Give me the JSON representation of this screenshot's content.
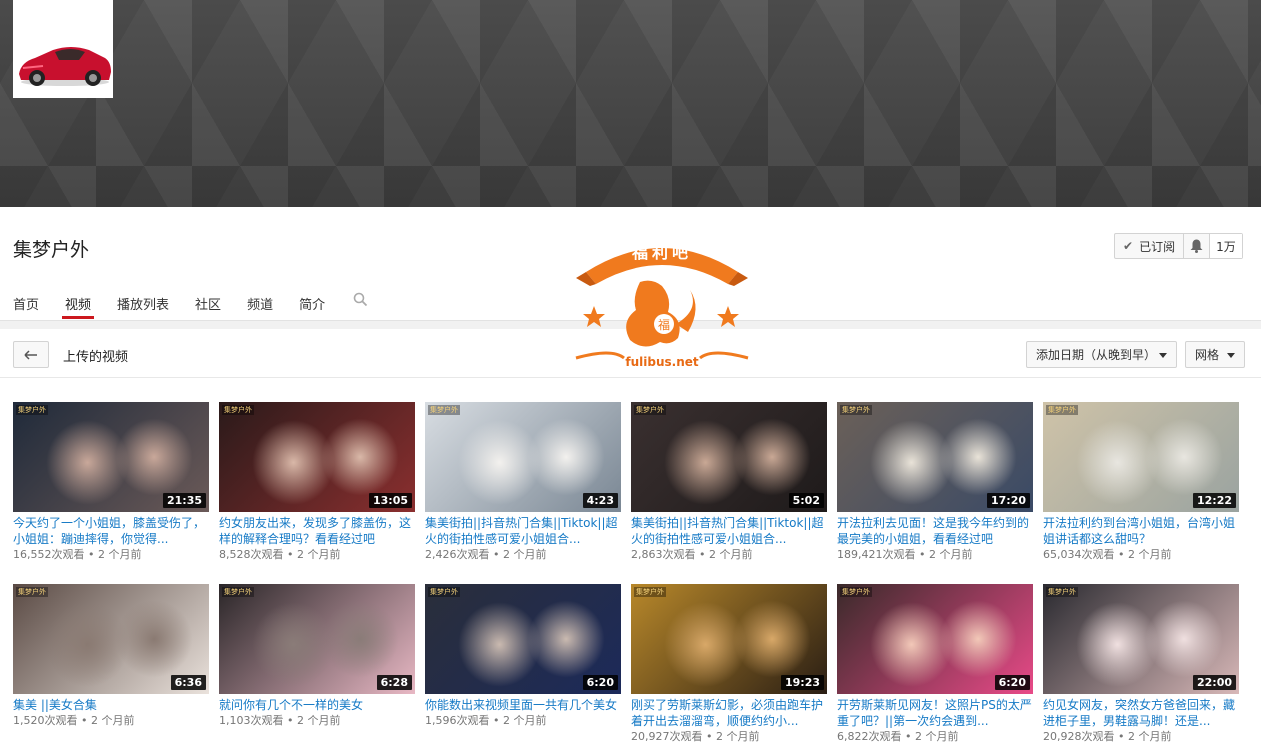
{
  "channel": {
    "name": "集梦户外",
    "subscribed_label": "已订阅",
    "subscriber_count": "1万"
  },
  "tabs": [
    "首页",
    "视频",
    "播放列表",
    "社区",
    "频道",
    "简介"
  ],
  "active_tab": "视频",
  "section": {
    "title": "上传的视频",
    "sort_label": "添加日期（从晚到早）",
    "view_label": "网格"
  },
  "watermark": {
    "top_text": "福利吧",
    "center_char": "福",
    "site": "fulibus.net"
  },
  "thumb_logo": "集梦户外",
  "videos": [
    {
      "title": "今天约了一个小姐姐，膝盖受伤了，小姐姐：蹦迪摔得，你觉得...",
      "duration": "21:35",
      "views": "16,552次观看",
      "date": "2 个月前",
      "colors": [
        "#1f2a3a",
        "#6b5a58",
        "#c9a89a"
      ]
    },
    {
      "title": "约女朋友出来，发现多了膝盖伤，这样的解释合理吗？看看经过吧",
      "duration": "13:05",
      "views": "8,528次观看",
      "date": "2 个月前",
      "colors": [
        "#2a1a1a",
        "#8b2f2f",
        "#d9b8a8"
      ]
    },
    {
      "title": "集美街拍||抖音热门合集||Tiktok||超火的街拍性感可爱小姐姐合...",
      "duration": "4:23",
      "views": "2,426次观看",
      "date": "2 个月前",
      "colors": [
        "#d8dde2",
        "#7a8794",
        "#f3f1ee"
      ]
    },
    {
      "title": "集美街拍||抖音热门合集||Tiktok||超火的街拍性感可爱小姐姐合...",
      "duration": "5:02",
      "views": "2,863次观看",
      "date": "2 个月前",
      "colors": [
        "#3a3030",
        "#1e1a1a",
        "#c9a895"
      ]
    },
    {
      "title": "开法拉利去见面！这是我今年约到的最完美的小姐姐，看看经过吧",
      "duration": "17:20",
      "views": "189,421次观看",
      "date": "2 个月前",
      "colors": [
        "#6b6058",
        "#3a4a66",
        "#e9e3d8"
      ]
    },
    {
      "title": "开法拉利约到台湾小姐姐，台湾小姐姐讲话都这么甜吗？",
      "duration": "12:22",
      "views": "65,034次观看",
      "date": "2 个月前",
      "colors": [
        "#cfc3a8",
        "#9aa3a0",
        "#e8e6e0"
      ]
    },
    {
      "title": "集美 ||美女合集",
      "duration": "6:36",
      "views": "1,520次观看",
      "date": "2 个月前",
      "colors": [
        "#5a4a44",
        "#eae2dc",
        "#8a7a72"
      ]
    },
    {
      "title": "就问你有几个不一样的美女",
      "duration": "6:28",
      "views": "1,103次观看",
      "date": "2 个月前",
      "colors": [
        "#2a2628",
        "#e8b8c4",
        "#8a7c78"
      ]
    },
    {
      "title": "你能数出来视频里面一共有几个美女嘛？",
      "duration": "6:20",
      "views": "1,596次观看",
      "date": "2 个月前",
      "colors": [
        "#2a2e3a",
        "#1c2a5a",
        "#cabab0"
      ]
    },
    {
      "title": "刚买了劳斯莱斯幻影，必须由跑车护着开出去溜溜弯，顺便约约小...",
      "duration": "19:23",
      "views": "20,927次观看",
      "date": "2 个月前",
      "colors": [
        "#b8882a",
        "#2a1e14",
        "#d8a868"
      ]
    },
    {
      "title": "开劳斯莱斯见网友！这照片PS的太严重了吧？||第一次约会遇到...",
      "duration": "6:20",
      "views": "6,822次观看",
      "date": "2 个月前",
      "colors": [
        "#3a2a2a",
        "#e84a88",
        "#f2c8b8"
      ]
    },
    {
      "title": "约见女网友，突然女方爸爸回来，藏进柜子里，男鞋露马脚！还是...",
      "duration": "22:00",
      "views": "20,928次观看",
      "date": "2 个月前",
      "colors": [
        "#2a2a30",
        "#d8b8b8",
        "#f0e0e0"
      ]
    }
  ]
}
